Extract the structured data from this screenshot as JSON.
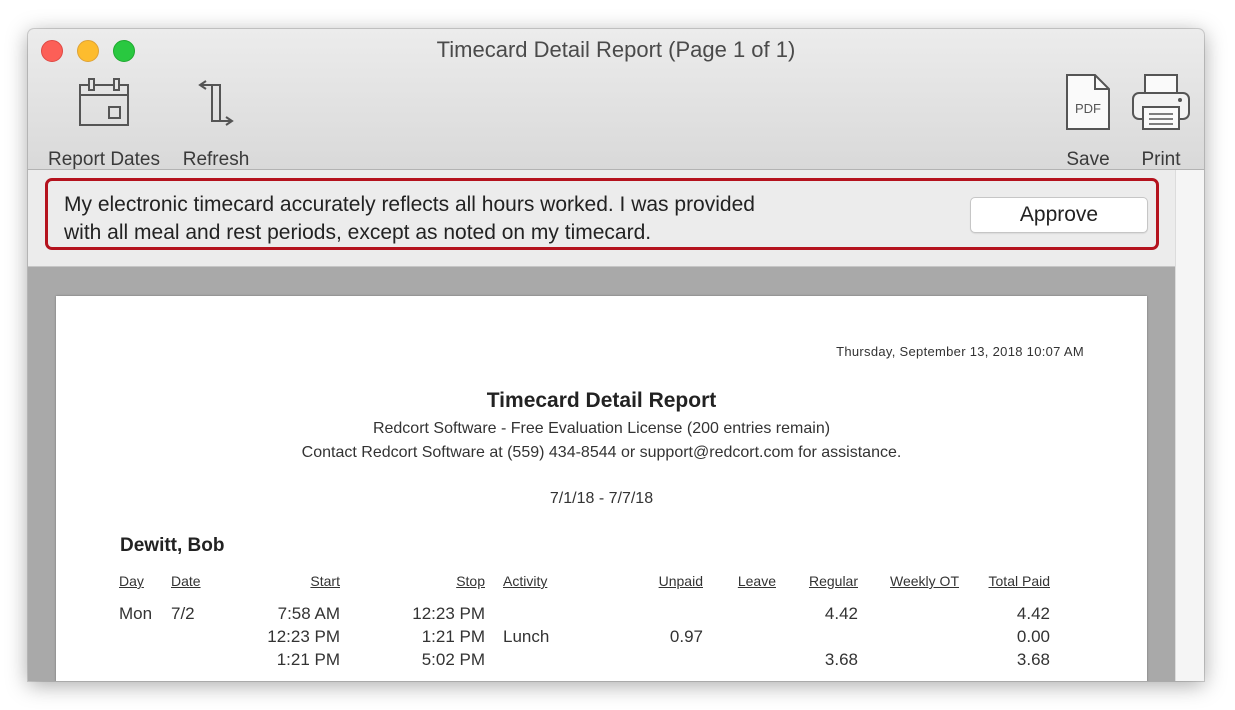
{
  "window": {
    "title": "Timecard Detail Report  (Page 1 of 1)"
  },
  "toolbar": {
    "report_dates_label": "Report Dates",
    "refresh_label": "Refresh",
    "save_label": "Save",
    "print_label": "Print",
    "pdf_icon_text": "PDF"
  },
  "approval": {
    "line1": "My electronic timecard accurately reflects all hours worked. I was provided",
    "line2": "with all meal and rest periods, except as noted on my timecard.",
    "button_label": "Approve",
    "highlight_color": "#b4121d"
  },
  "report": {
    "timestamp": "Thursday, September 13, 2018  10:07 AM",
    "title": "Timecard Detail Report",
    "subtitle1": "Redcort Software - Free Evaluation License (200 entries remain)",
    "subtitle2": "Contact Redcort Software at (559) 434-8544 or support@redcort.com for assistance.",
    "date_range": "7/1/18 - 7/7/18",
    "employee": "Dewitt, Bob",
    "columns": [
      "Day",
      "Date",
      "Start",
      "Stop",
      "Activity",
      "Unpaid",
      "Leave",
      "Regular",
      "Weekly OT",
      "Total Paid"
    ],
    "rows": [
      {
        "day": "Mon",
        "date": "7/2",
        "start": "7:58 AM",
        "stop": "12:23 PM",
        "activity": "",
        "unpaid": "",
        "leave": "",
        "regular": "4.42",
        "weekly_ot": "",
        "total_paid": "4.42"
      },
      {
        "day": "",
        "date": "",
        "start": "12:23 PM",
        "stop": "1:21 PM",
        "activity": "Lunch",
        "unpaid": "0.97",
        "leave": "",
        "regular": "",
        "weekly_ot": "",
        "total_paid": "0.00"
      },
      {
        "day": "",
        "date": "",
        "start": "1:21 PM",
        "stop": "5:02 PM",
        "activity": "",
        "unpaid": "",
        "leave": "",
        "regular": "3.68",
        "weekly_ot": "",
        "total_paid": "3.68"
      }
    ]
  }
}
